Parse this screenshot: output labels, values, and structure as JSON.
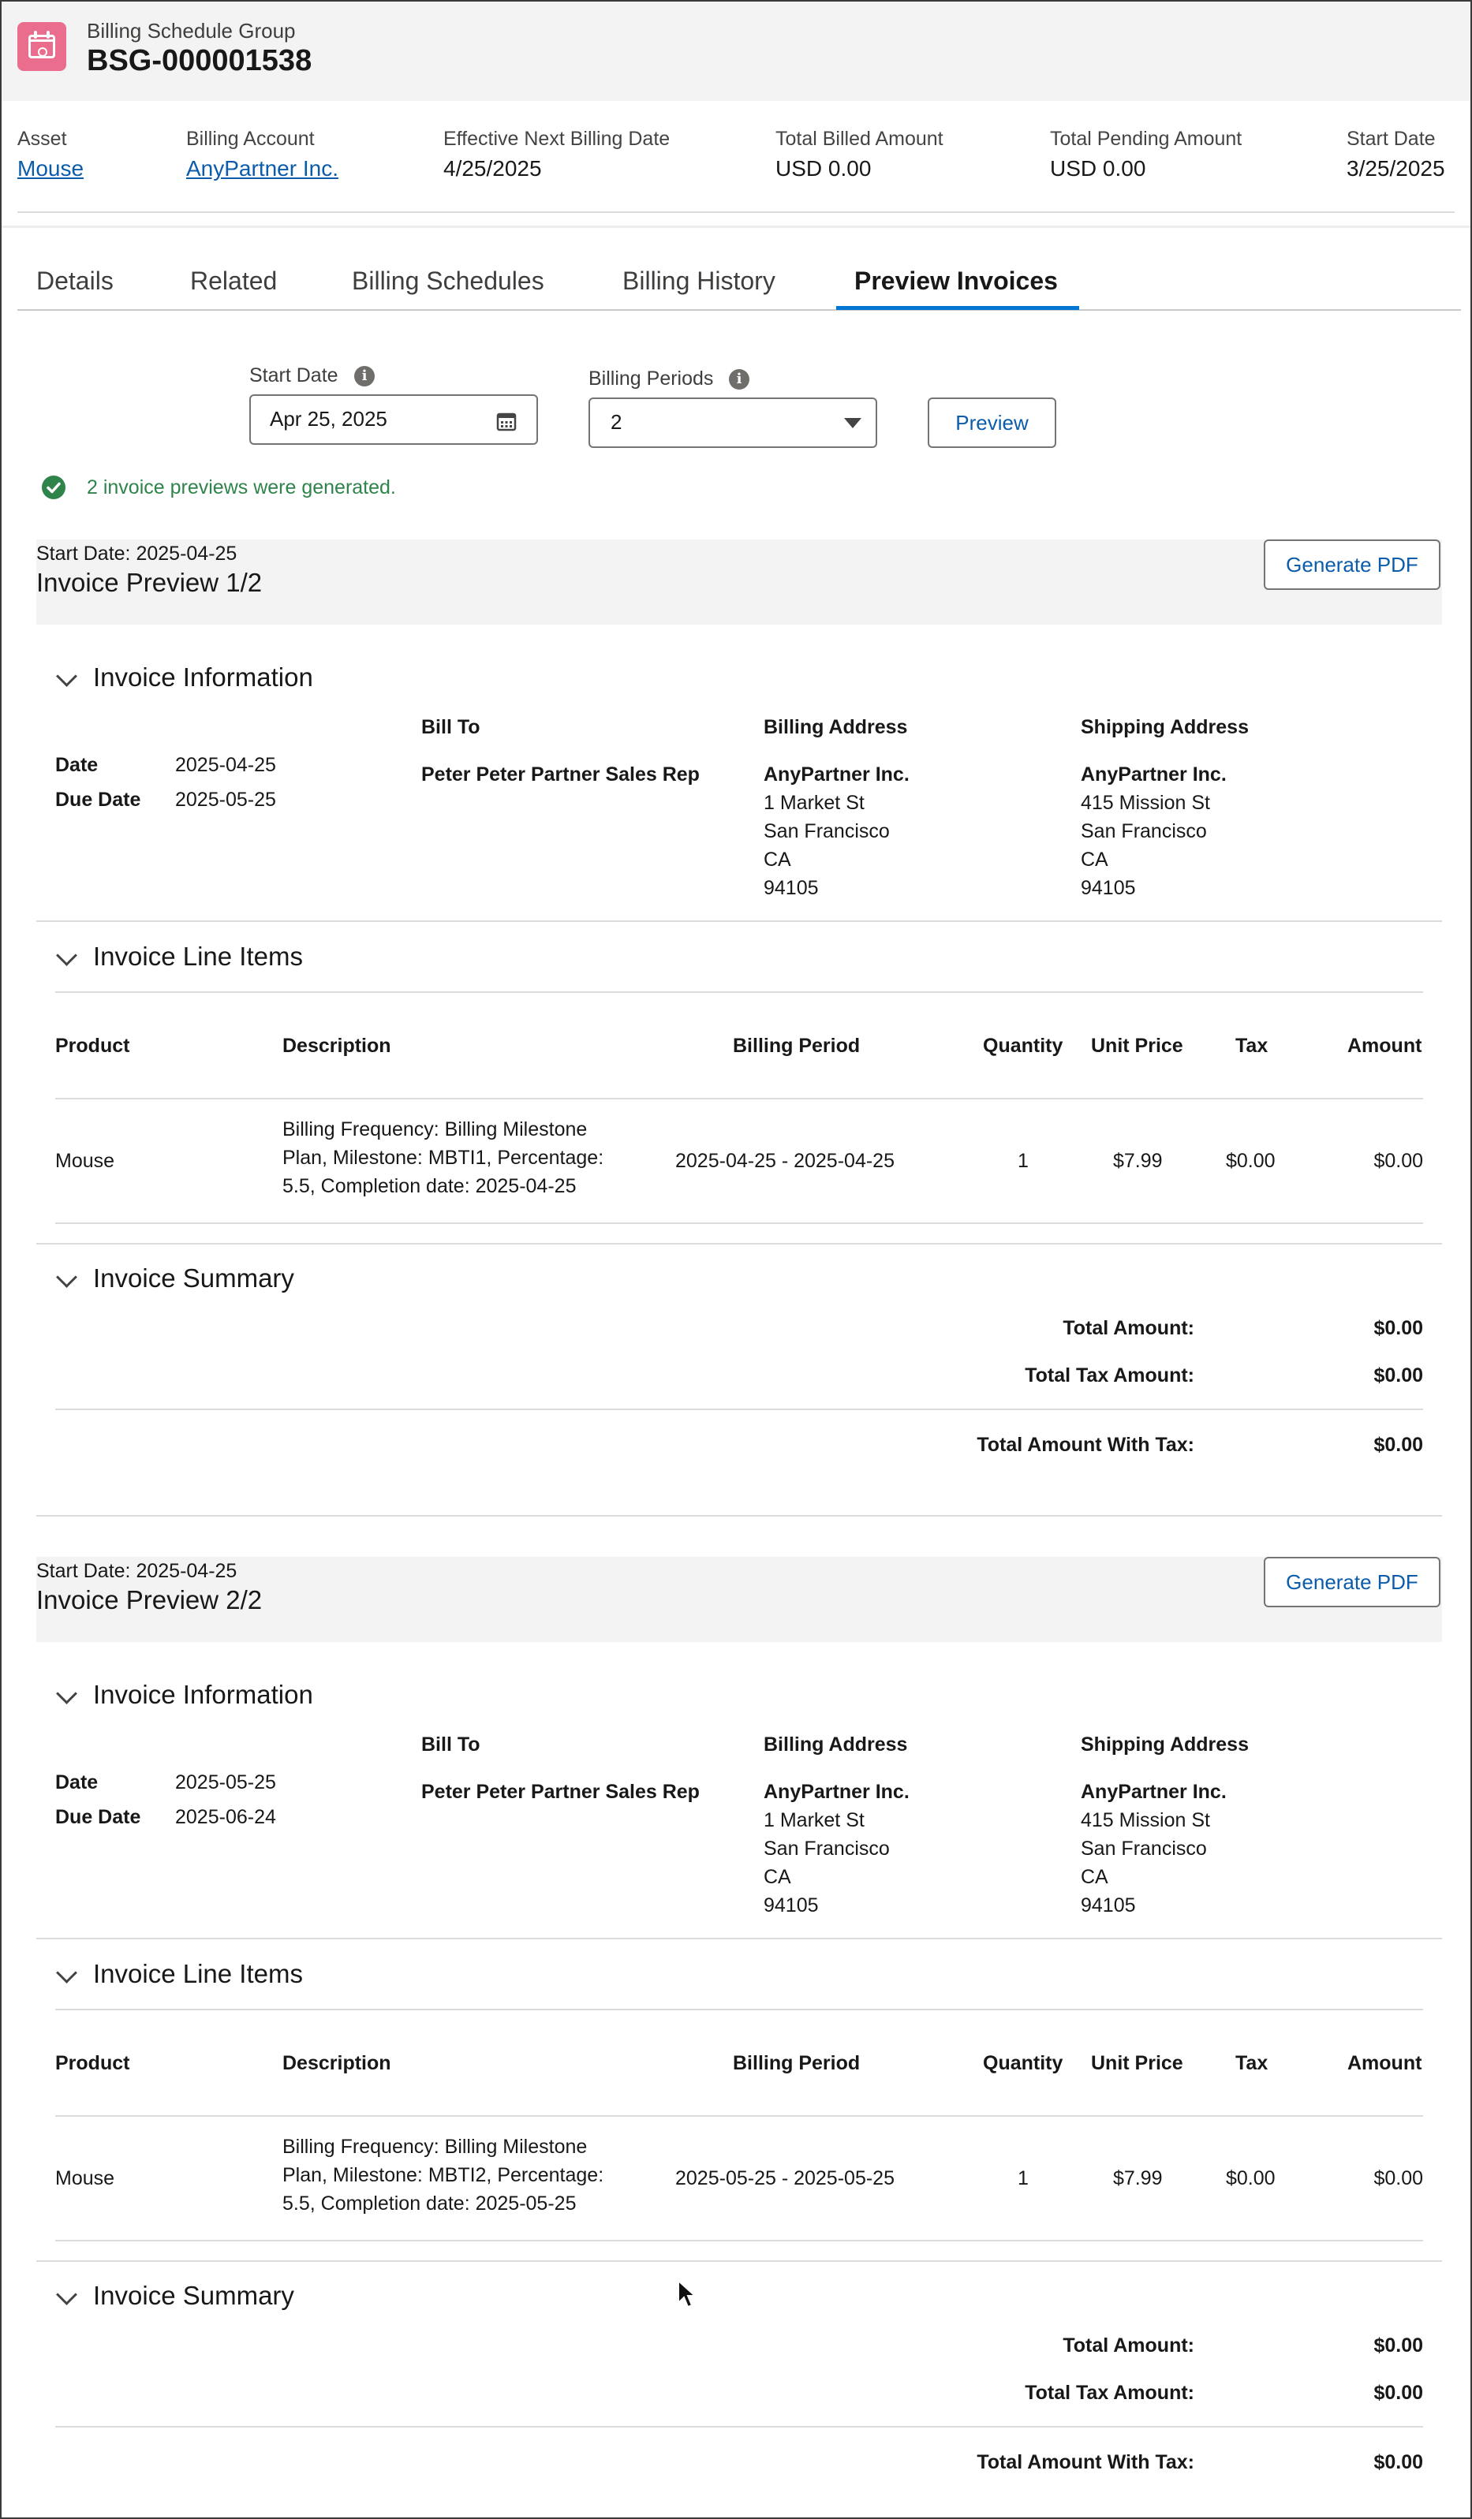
{
  "header": {
    "object_type": "Billing Schedule Group",
    "record_name": "BSG-000001538"
  },
  "highlights": [
    {
      "label": "Asset",
      "value": "Mouse",
      "link": true
    },
    {
      "label": "Billing Account",
      "value": "AnyPartner Inc.",
      "link": true
    },
    {
      "label": "Effective Next Billing Date",
      "value": "4/25/2025",
      "link": false
    },
    {
      "label": "Total Billed Amount",
      "value": "USD 0.00",
      "link": false
    },
    {
      "label": "Total Pending Amount",
      "value": "USD 0.00",
      "link": false
    },
    {
      "label": "Start Date",
      "value": "3/25/2025",
      "link": false
    }
  ],
  "tabs": [
    "Details",
    "Related",
    "Billing Schedules",
    "Billing History",
    "Preview Invoices"
  ],
  "active_tab": "Preview Invoices",
  "controls": {
    "start_date_label": "Start Date",
    "start_date_value": "Apr 25, 2025",
    "billing_periods_label": "Billing Periods",
    "billing_periods_value": "2",
    "preview_button": "Preview",
    "success_message": "2 invoice previews were generated."
  },
  "invoice_labels": {
    "start_date_prefix": "Start Date: ",
    "generate_pdf": "Generate PDF",
    "section_info": "Invoice Information",
    "section_lines": "Invoice Line Items",
    "section_summary": "Invoice Summary",
    "date": "Date",
    "due_date": "Due Date",
    "bill_to": "Bill To",
    "billing_address": "Billing Address",
    "shipping_address": "Shipping Address",
    "col_product": "Product",
    "col_description": "Description",
    "col_billing_period": "Billing Period",
    "col_quantity": "Quantity",
    "col_unit_price": "Unit Price",
    "col_tax": "Tax",
    "col_amount": "Amount",
    "total_amount": "Total Amount:",
    "total_tax": "Total Tax Amount:",
    "total_with_tax": "Total Amount With Tax:"
  },
  "invoices": [
    {
      "start_date": "2025-04-25",
      "title": "Invoice Preview 1/2",
      "date": "2025-04-25",
      "due_date": "2025-05-25",
      "bill_to": "Peter Peter Partner Sales Rep",
      "billing_address": [
        "AnyPartner Inc.",
        "1 Market St",
        "San Francisco",
        "CA",
        "94105"
      ],
      "shipping_address": [
        "AnyPartner Inc.",
        "415 Mission St",
        "San Francisco",
        "CA",
        "94105"
      ],
      "line": {
        "product": "Mouse",
        "description": [
          "Billing Frequency: Billing Milestone",
          "Plan, Milestone: MBTI1, Percentage:",
          "5.5, Completion date: 2025-04-25"
        ],
        "billing_period": "2025-04-25 - 2025-04-25",
        "quantity": "1",
        "unit_price": "$7.99",
        "tax": "$0.00",
        "amount": "$0.00"
      },
      "totals": {
        "amount": "$0.00",
        "tax": "$0.00",
        "with_tax": "$0.00"
      }
    },
    {
      "start_date": "2025-04-25",
      "title": "Invoice Preview 2/2",
      "date": "2025-05-25",
      "due_date": "2025-06-24",
      "bill_to": "Peter Peter Partner Sales Rep",
      "billing_address": [
        "AnyPartner Inc.",
        "1 Market St",
        "San Francisco",
        "CA",
        "94105"
      ],
      "shipping_address": [
        "AnyPartner Inc.",
        "415 Mission St",
        "San Francisco",
        "CA",
        "94105"
      ],
      "line": {
        "product": "Mouse",
        "description": [
          "Billing Frequency: Billing Milestone",
          "Plan, Milestone: MBTI2, Percentage:",
          "5.5, Completion date: 2025-05-25"
        ],
        "billing_period": "2025-05-25 - 2025-05-25",
        "quantity": "1",
        "unit_price": "$7.99",
        "tax": "$0.00",
        "amount": "$0.00"
      },
      "totals": {
        "amount": "$0.00",
        "tax": "$0.00",
        "with_tax": "$0.00"
      }
    }
  ],
  "colors": {
    "brand_blue": "#0176d3",
    "link": "#0b5cab",
    "success": "#2e844a",
    "icon_pink": "#ea6d8d"
  }
}
